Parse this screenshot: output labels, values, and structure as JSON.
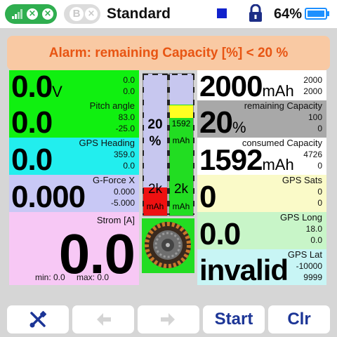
{
  "topbar": {
    "model_name": "Standard",
    "battery_percent": "64%",
    "trainer_badge": "B"
  },
  "alarm": {
    "text": "Alarm: remaining Capacity [%] < 20 %"
  },
  "left_tiles": {
    "voltage": {
      "value": "0.0",
      "unit": "V",
      "max": "0.0",
      "min": "0.0",
      "color": "#10f010"
    },
    "pitch": {
      "title": "Pitch angle",
      "value": "0.0",
      "max": "83.0",
      "min": "-25.0",
      "color": "#10f010"
    },
    "heading": {
      "title": "GPS Heading",
      "value": "0.0",
      "max": "359.0",
      "min": "0.0",
      "color": "#22eeee"
    },
    "gforce": {
      "title": "G-Force X",
      "value": "0.000",
      "max": "0.000",
      "min": "-5.000",
      "color": "#c8c8f5"
    },
    "current": {
      "title": "Strom [A]",
      "value": "0.0",
      "min_label": "min: 0.0",
      "max_label": "max: 0.0",
      "color": "#f7c8f5"
    }
  },
  "gauges": {
    "percent_gauge": {
      "value_text": "20",
      "unit_text": "%",
      "bottom_text": "2k",
      "bottom_unit": "mAh",
      "fill_fraction": 0.2
    },
    "mah_gauge": {
      "value_text": "1592",
      "unit_text": "mAh",
      "bottom_text": "2k",
      "bottom_unit": "mAh",
      "fill_fraction": 0.8
    }
  },
  "right_tiles": {
    "capacity": {
      "value": "2000",
      "unit": "mAh",
      "max": "2000",
      "min": "2000",
      "color": "#ffffff"
    },
    "remaining": {
      "title": "remaining Capacity",
      "value": "20",
      "unit": "%",
      "max": "100",
      "min": "0",
      "color": "#a8a8a8"
    },
    "consumed": {
      "title": "consumed Capacity",
      "value": "1592",
      "unit": "mAh",
      "max": "4726",
      "min": "0",
      "color": "#ffffff"
    },
    "gps_sats": {
      "title": "GPS Sats",
      "value": "0",
      "max": "0",
      "min": "0",
      "color": "#fafac8"
    },
    "gps_long": {
      "title": "GPS Long",
      "value": "0.0",
      "max": "18.0",
      "min": "0.0",
      "color": "#c8f5c8"
    },
    "gps_lat": {
      "title": "GPS Lat",
      "value": "invalid",
      "max": "-10000",
      "min": "9999",
      "color": "#c8f5f5"
    }
  },
  "buttons": {
    "start_label": "Start",
    "clear_label": "Clr"
  },
  "icons": {
    "tools": "wrench-screwdriver-icon",
    "prev": "arrow-left-icon",
    "next": "arrow-right-icon",
    "lock": "lock-icon",
    "battery": "battery-icon"
  },
  "colors": {
    "accent_blue": "#1c3596",
    "alarm_text": "#e85513",
    "alarm_bg": "#f9c9a3",
    "battery_blue": "#1e90ff"
  }
}
